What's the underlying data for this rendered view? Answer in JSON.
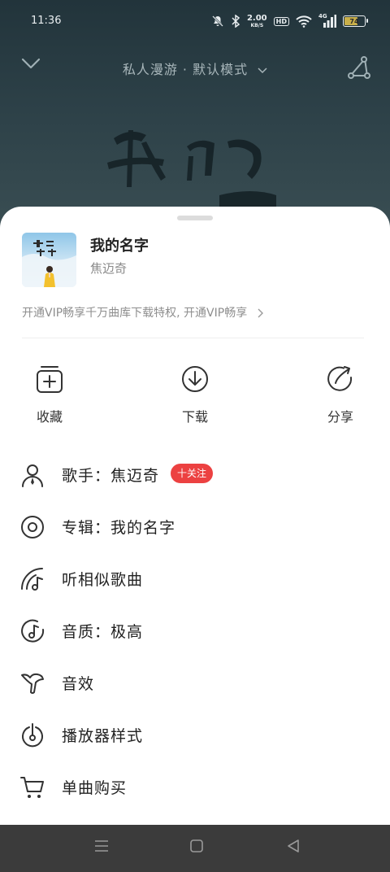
{
  "status_bar": {
    "time": "11:36",
    "net_speed_value": "2.00",
    "net_speed_unit": "KB/S",
    "hd_label": "HD",
    "network_label": "4G",
    "battery_level": "74",
    "battery_fraction": 0.74
  },
  "player": {
    "mode_label": "私人漫游 · 默认模式"
  },
  "sheet": {
    "song": {
      "title": "我的名字",
      "artist": "焦迈奇"
    },
    "vip_banner": "开通VIP畅享千万曲库下载特权, 开通VIP畅享",
    "actions": [
      {
        "label": "收藏",
        "icon": "collect-icon"
      },
      {
        "label": "下载",
        "icon": "download-icon"
      },
      {
        "label": "分享",
        "icon": "share-icon"
      }
    ],
    "menu": [
      {
        "label": "歌手：焦迈奇",
        "icon": "singer-icon",
        "badge": "十关注"
      },
      {
        "label": "专辑：我的名字",
        "icon": "album-icon"
      },
      {
        "label": "听相似歌曲",
        "icon": "similar-songs-icon"
      },
      {
        "label": "音质：极高",
        "icon": "quality-icon"
      },
      {
        "label": "音效",
        "icon": "sound-effect-icon"
      },
      {
        "label": "播放器样式",
        "icon": "player-style-icon"
      },
      {
        "label": "单曲购买",
        "icon": "cart-icon"
      }
    ]
  },
  "colors": {
    "accent": "#ec4141",
    "background_top": "#22343b",
    "sheet": "#ffffff",
    "nav_bar": "#3b3b3b"
  }
}
